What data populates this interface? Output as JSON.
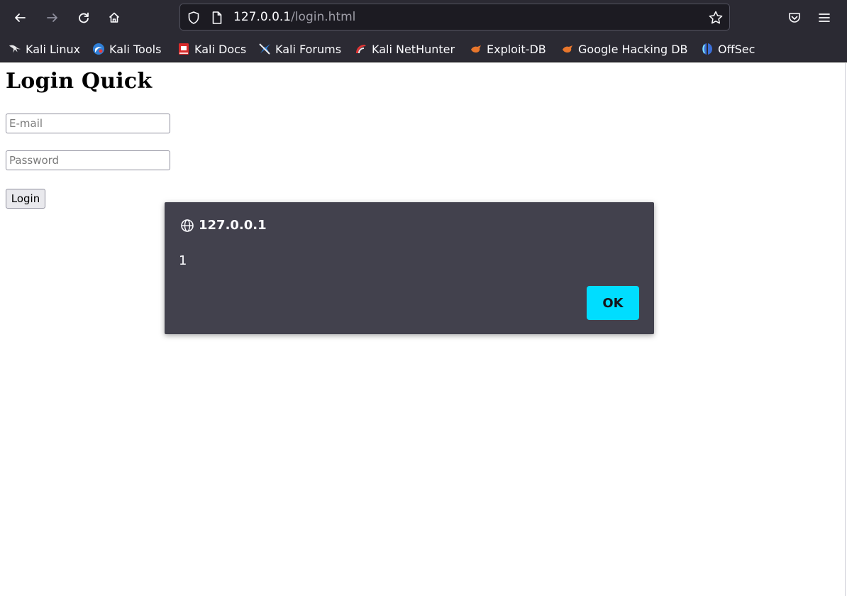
{
  "browser": {
    "url_host": "127.0.0.1",
    "url_path": "/login.html",
    "icons": {
      "back": "back-arrow-icon",
      "forward": "forward-arrow-icon",
      "reload": "reload-icon",
      "home": "home-icon",
      "shield": "tracking-protection-shield-icon",
      "page": "page-icon",
      "bookmark_star": "star-icon",
      "pocket": "pocket-icon",
      "menu": "hamburger-menu-icon"
    },
    "colors": {
      "toolbar_bg": "#2b2a33",
      "urlbar_bg": "#1c1b22",
      "dialog_bg": "#42414d",
      "accent": "#00ddff"
    }
  },
  "bookmarks": [
    {
      "label": "Kali Linux",
      "icon": "kali-dragon-icon"
    },
    {
      "label": "Kali Tools",
      "icon": "kali-tools-icon"
    },
    {
      "label": "Kali Docs",
      "icon": "kali-docs-icon"
    },
    {
      "label": "Kali Forums",
      "icon": "kali-forums-icon"
    },
    {
      "label": "Kali NetHunter",
      "icon": "nethunter-icon"
    },
    {
      "label": "Exploit-DB",
      "icon": "exploit-db-icon"
    },
    {
      "label": "Google Hacking DB",
      "icon": "ghdb-icon"
    },
    {
      "label": "OffSec",
      "icon": "offsec-icon"
    }
  ],
  "page": {
    "title": "Login Quick",
    "email": {
      "placeholder": "E-mail",
      "value": ""
    },
    "password": {
      "placeholder": "Password",
      "value": ""
    },
    "login_label": "Login"
  },
  "dialog": {
    "origin": "127.0.0.1",
    "message": "1",
    "ok_label": "OK",
    "icon": "globe-icon"
  }
}
